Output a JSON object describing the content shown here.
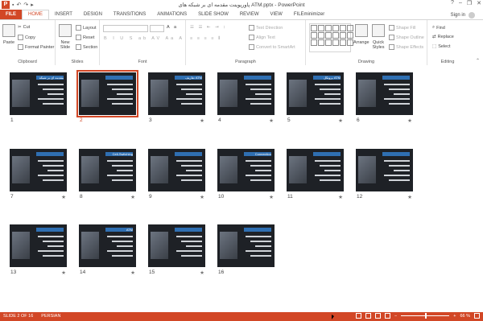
{
  "titlebar": {
    "title": "پاورپوینت مقدمه ای بر شبکه های ATM.pptx - PowerPoint",
    "app_icon": "P",
    "window_controls": [
      "?",
      "–",
      "❐",
      "✕"
    ]
  },
  "tabs": [
    "FILE",
    "HOME",
    "INSERT",
    "DESIGN",
    "TRANSITIONS",
    "ANIMATIONS",
    "SLIDE SHOW",
    "REVIEW",
    "VIEW",
    "FILEminimizer"
  ],
  "signin": "Sign in",
  "ribbon": {
    "clipboard": {
      "label": "Clipboard",
      "paste": "Paste",
      "cut": "Cut",
      "copy": "Copy",
      "format_painter": "Format Painter"
    },
    "slides": {
      "label": "Slides",
      "new_slide": "New Slide",
      "layout": "Layout",
      "reset": "Reset",
      "section": "Section"
    },
    "font": {
      "label": "Font"
    },
    "paragraph": {
      "label": "Paragraph",
      "text_direction": "Text Direction",
      "align_text": "Align Text",
      "convert": "Convert to SmartArt"
    },
    "drawing": {
      "label": "Drawing",
      "arrange": "Arrange",
      "quick_styles": "Quick Styles",
      "shape_fill": "Shape Fill",
      "shape_outline": "Shape Outline",
      "shape_effects": "Shape Effects"
    },
    "editing": {
      "label": "Editing",
      "find": "Find",
      "replace": "Replace",
      "select": "Select"
    }
  },
  "slides": [
    {
      "number": "1",
      "title": "مقدمه ای بر شبکه های ATM",
      "star": "",
      "selected": false
    },
    {
      "number": "2",
      "title": "",
      "star": "",
      "selected": true
    },
    {
      "number": "3",
      "title": "تعاریف ATM",
      "star": "★",
      "selected": false
    },
    {
      "number": "4",
      "title": "",
      "star": "★",
      "selected": false
    },
    {
      "number": "5",
      "title": "پروتکل ATM",
      "star": "★",
      "selected": false
    },
    {
      "number": "6",
      "title": "",
      "star": "★",
      "selected": false
    },
    {
      "number": "7",
      "title": "",
      "star": "★",
      "selected": false
    },
    {
      "number": "8",
      "title": "Cell-Switching",
      "star": "★",
      "selected": false
    },
    {
      "number": "9",
      "title": "",
      "star": "★",
      "selected": false
    },
    {
      "number": "10",
      "title": "Connection Oriented",
      "star": "★",
      "selected": false
    },
    {
      "number": "11",
      "title": "",
      "star": "★",
      "selected": false
    },
    {
      "number": "12",
      "title": "",
      "star": "★",
      "selected": false
    },
    {
      "number": "13",
      "title": "",
      "star": "★",
      "selected": false
    },
    {
      "number": "14",
      "title": "ATM",
      "star": "★",
      "selected": false
    },
    {
      "number": "15",
      "title": "",
      "star": "★",
      "selected": false
    },
    {
      "number": "16",
      "title": "",
      "star": "",
      "selected": false
    }
  ],
  "status": {
    "slide_info": "SLIDE 2 OF 16",
    "language": "PERSIAN",
    "zoom": "66 %"
  },
  "colors": {
    "accent": "#d24726"
  }
}
